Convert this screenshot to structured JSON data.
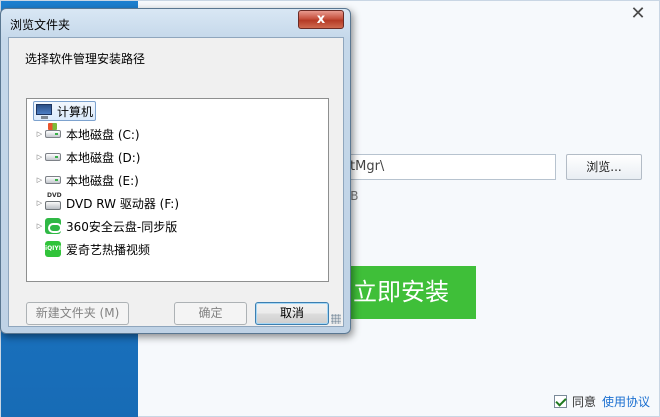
{
  "installer": {
    "path_value": "tMgr\\",
    "browse_label": "浏览...",
    "space_text": "GB",
    "install_label": "立即安装",
    "agree_label": "同意",
    "agreement_link": "使用协议",
    "close_glyph": "✕"
  },
  "dialog": {
    "title": "浏览文件夹",
    "close_glyph": "x",
    "prompt": "选择软件管理安装路径",
    "tree": {
      "root": {
        "label": "计算机",
        "icon": "computer-icon"
      },
      "items": [
        {
          "label": "本地磁盘 (C:)",
          "icon": "windows-drive-icon"
        },
        {
          "label": "本地磁盘 (D:)",
          "icon": "hard-drive-icon"
        },
        {
          "label": "本地磁盘 (E:)",
          "icon": "hard-drive-icon"
        },
        {
          "label": "DVD RW 驱动器 (F:)",
          "icon": "dvd-drive-icon"
        },
        {
          "label": "360安全云盘-同步版",
          "icon": "cloud-drive-icon"
        },
        {
          "label": "爱奇艺热播视频",
          "icon": "iqiyi-icon"
        }
      ],
      "iqiyi_icon_text": "iQIYI"
    },
    "buttons": {
      "new_folder": "新建文件夹 (M)",
      "ok": "确定",
      "cancel": "取消"
    }
  },
  "colors": {
    "install_green": "#3fbf39",
    "sidebar_blue": "#1b74c2",
    "link_blue": "#1a6fd0"
  }
}
